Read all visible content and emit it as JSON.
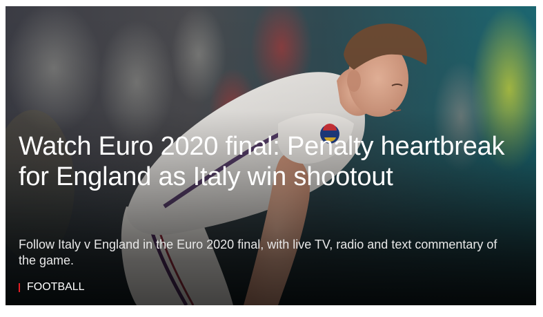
{
  "card": {
    "headline": "Watch Euro 2020 final: Penalty heartbreak for England as Italy win shootout",
    "summary": "Follow Italy v England in the Euro 2020 final, with live TV, radio and text commentary of the game.",
    "section_label": "FOOTBALL",
    "image_alt": "England footballer bent over with hands on knees",
    "accent_color": "#e31e24"
  }
}
